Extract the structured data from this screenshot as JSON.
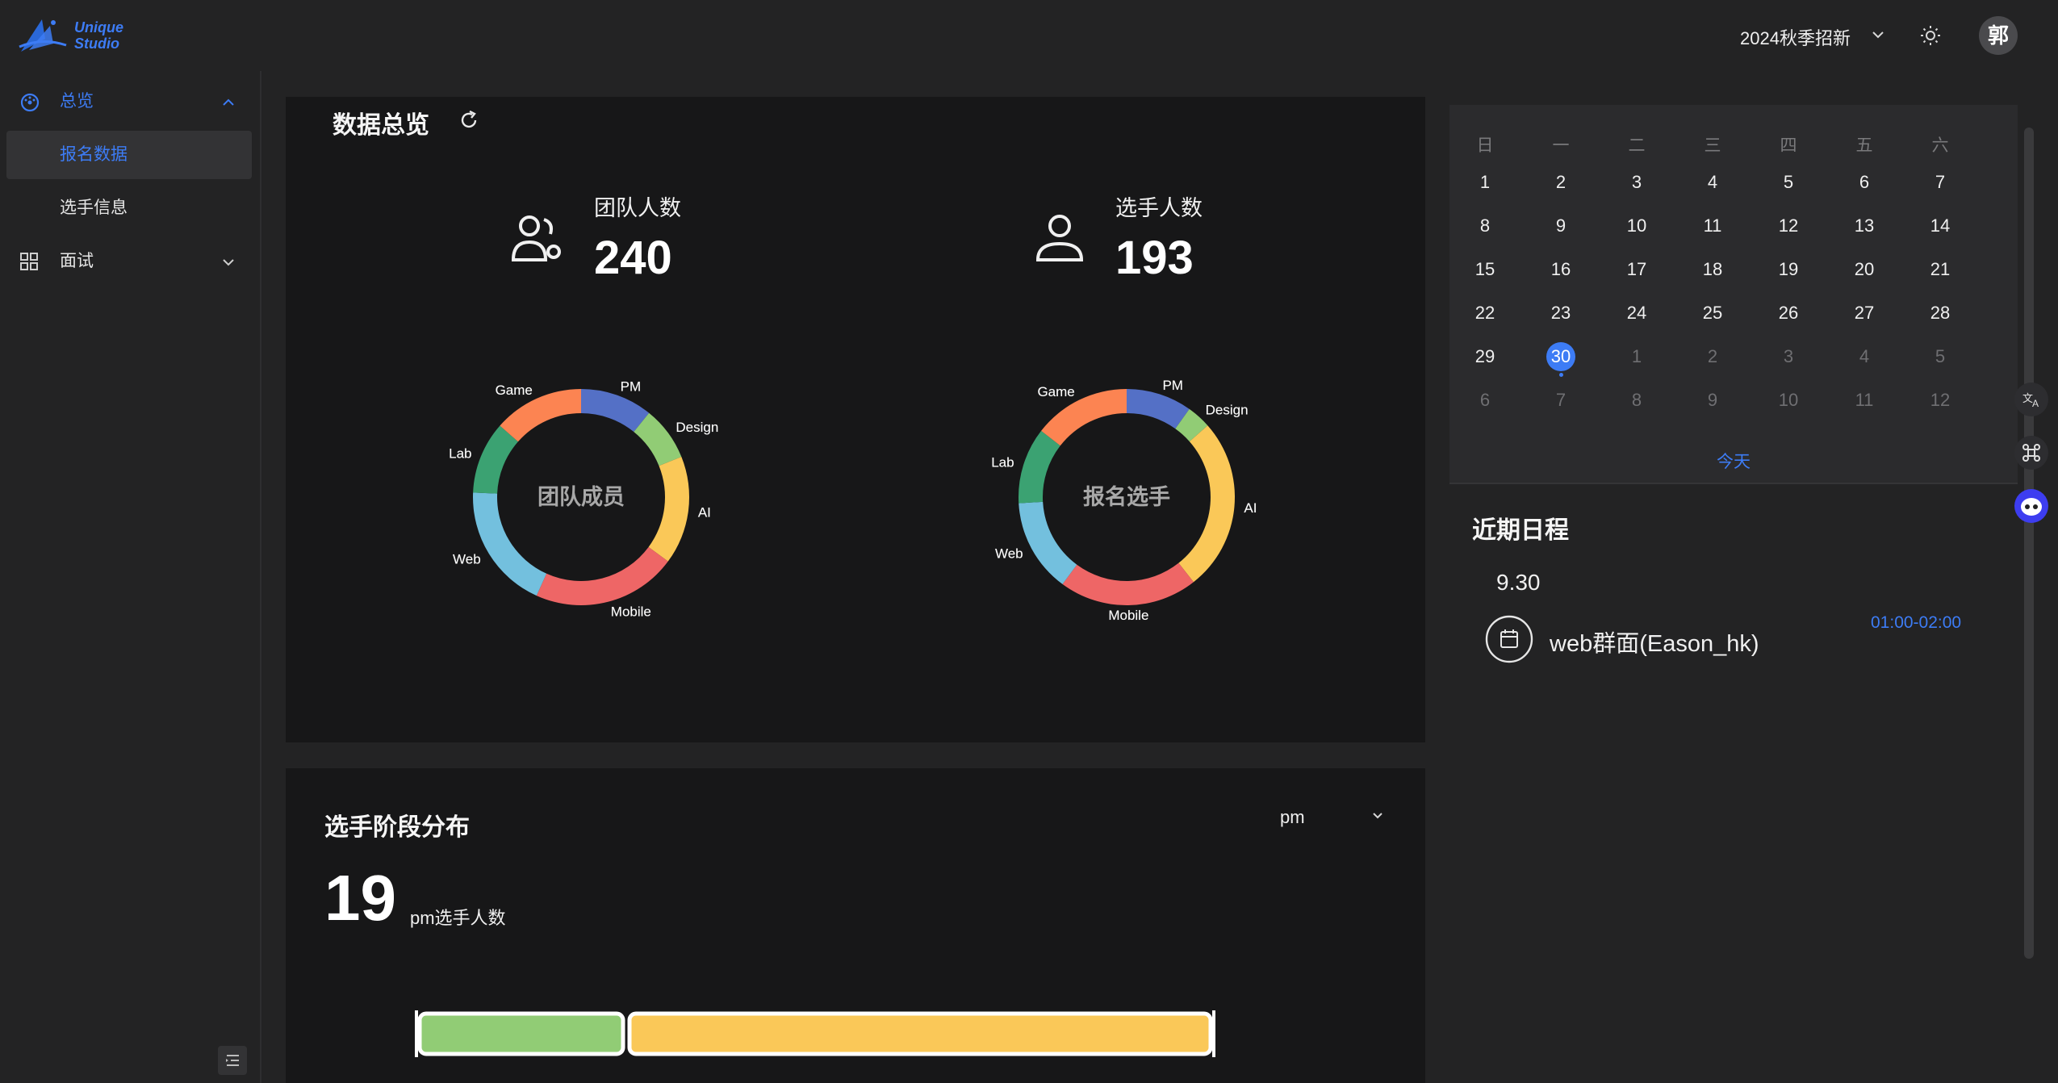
{
  "header": {
    "logo_text_line1": "Unique",
    "logo_text_line2": "Studio",
    "season_select": "2024秋季招新",
    "user_avatar": "郭"
  },
  "sidebar": {
    "groups": [
      {
        "label": "总览",
        "icon": "dashboard-icon",
        "expanded": true,
        "children": [
          {
            "label": "报名数据",
            "active": true
          },
          {
            "label": "选手信息",
            "active": false
          }
        ]
      },
      {
        "label": "面试",
        "icon": "grid-icon",
        "expanded": false
      }
    ]
  },
  "overview": {
    "title": "数据总览",
    "stats": [
      {
        "label": "团队人数",
        "value": "240",
        "icon": "users-icon"
      },
      {
        "label": "选手人数",
        "value": "193",
        "icon": "user-icon"
      }
    ],
    "charts": [
      {
        "center_label": "团队成员"
      },
      {
        "center_label": "报名选手"
      }
    ]
  },
  "chart_data": [
    {
      "type": "pie",
      "variant": "donut",
      "title": "团队成员",
      "categories": [
        "PM",
        "Design",
        "AI",
        "Mobile",
        "Web",
        "Lab",
        "Game"
      ],
      "values": [
        20,
        15,
        30,
        40,
        35,
        20,
        25
      ],
      "colors": [
        "#5470c6",
        "#91cc75",
        "#fac858",
        "#ee6666",
        "#73c0de",
        "#3ba272",
        "#fc8452"
      ]
    },
    {
      "type": "pie",
      "variant": "donut",
      "title": "报名选手",
      "categories": [
        "PM",
        "Design",
        "AI",
        "Mobile",
        "Web",
        "Lab",
        "Game"
      ],
      "values": [
        19,
        7,
        50,
        40,
        27,
        22,
        28
      ],
      "colors": [
        "#5470c6",
        "#91cc75",
        "#fac858",
        "#ee6666",
        "#73c0de",
        "#3ba272",
        "#fc8452"
      ]
    },
    {
      "type": "bar",
      "variant": "stacked-horizontal",
      "categories": [
        "pm"
      ],
      "series": [
        {
          "values": [
            5
          ],
          "color": "#91cc75"
        },
        {
          "values": [
            14
          ],
          "color": "#fac858"
        }
      ]
    }
  ],
  "stage": {
    "title": "选手阶段分布",
    "group_select": "pm",
    "count": "19",
    "count_label": "pm选手人数"
  },
  "calendar": {
    "weekdays": [
      "日",
      "一",
      "二",
      "三",
      "四",
      "五",
      "六"
    ],
    "weeks": [
      [
        {
          "d": "1"
        },
        {
          "d": "2"
        },
        {
          "d": "3"
        },
        {
          "d": "4"
        },
        {
          "d": "5"
        },
        {
          "d": "6"
        },
        {
          "d": "7"
        }
      ],
      [
        {
          "d": "8"
        },
        {
          "d": "9"
        },
        {
          "d": "10"
        },
        {
          "d": "11"
        },
        {
          "d": "12"
        },
        {
          "d": "13"
        },
        {
          "d": "14"
        }
      ],
      [
        {
          "d": "15"
        },
        {
          "d": "16"
        },
        {
          "d": "17"
        },
        {
          "d": "18"
        },
        {
          "d": "19"
        },
        {
          "d": "20"
        },
        {
          "d": "21"
        }
      ],
      [
        {
          "d": "22"
        },
        {
          "d": "23"
        },
        {
          "d": "24"
        },
        {
          "d": "25"
        },
        {
          "d": "26"
        },
        {
          "d": "27"
        },
        {
          "d": "28"
        }
      ],
      [
        {
          "d": "29"
        },
        {
          "d": "30",
          "today": true
        },
        {
          "d": "1",
          "dim": true
        },
        {
          "d": "2",
          "dim": true
        },
        {
          "d": "3",
          "dim": true
        },
        {
          "d": "4",
          "dim": true
        },
        {
          "d": "5",
          "dim": true
        }
      ],
      [
        {
          "d": "6",
          "dim": true
        },
        {
          "d": "7",
          "dim": true
        },
        {
          "d": "8",
          "dim": true
        },
        {
          "d": "9",
          "dim": true
        },
        {
          "d": "10",
          "dim": true
        },
        {
          "d": "11",
          "dim": true
        },
        {
          "d": "12",
          "dim": true
        }
      ]
    ],
    "today_label": "今天"
  },
  "schedule": {
    "title": "近期日程",
    "date": "9.30",
    "events": [
      {
        "title": "web群面(Eason_hk)",
        "time": "01:00-02:00"
      }
    ]
  },
  "colors": {
    "accent": "#3d7cf5",
    "panel": "#171718",
    "background": "#232324"
  }
}
